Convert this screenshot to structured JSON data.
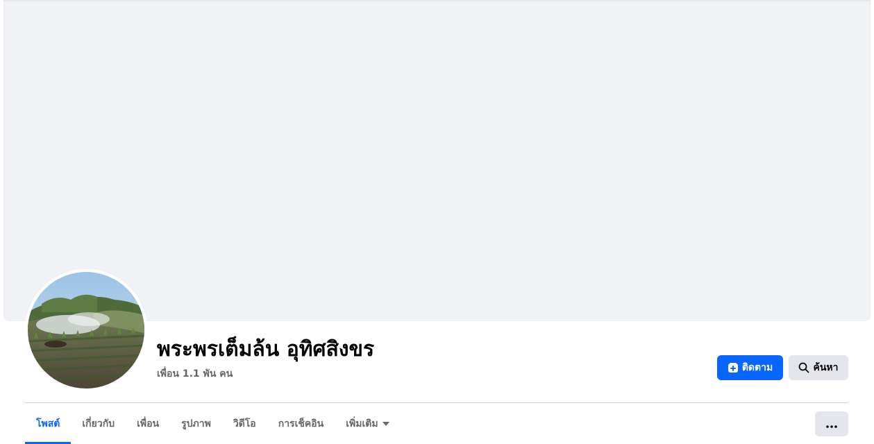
{
  "profile": {
    "name": "พระพรเต็มล้น อุทิศสิงขร",
    "friends_text": "เพื่อน 1.1 พัน คน"
  },
  "actions": {
    "follow_label": "ติดตาม",
    "search_label": "ค้นหา"
  },
  "tabs": [
    {
      "label": "โพสต์",
      "active": true
    },
    {
      "label": "เกี่ยวกับ",
      "active": false
    },
    {
      "label": "เพื่อน",
      "active": false
    },
    {
      "label": "รูปภาพ",
      "active": false
    },
    {
      "label": "วิดีโอ",
      "active": false
    },
    {
      "label": "การเช็คอิน",
      "active": false
    },
    {
      "label": "เพิ่มเติม",
      "active": false,
      "icon": "caret-down-icon"
    }
  ],
  "icons": {
    "follow": "follow-page-icon",
    "search": "search-icon",
    "more": "more-dots-icon"
  },
  "colors": {
    "accent": "#0866ff",
    "cover_bg": "#f0f2f5",
    "secondary_button": "#e4e6eb",
    "muted_text": "#65676b"
  }
}
